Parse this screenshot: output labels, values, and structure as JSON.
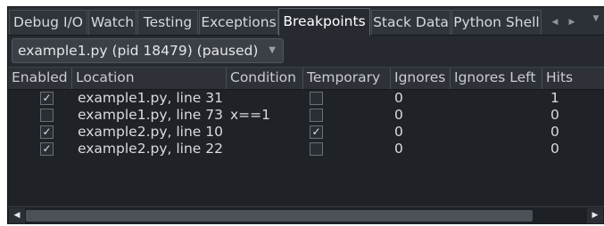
{
  "tabs": [
    {
      "label": "Debug I/O",
      "active": false
    },
    {
      "label": "Watch",
      "active": false
    },
    {
      "label": "Testing",
      "active": false
    },
    {
      "label": "Exceptions",
      "active": false
    },
    {
      "label": "Breakpoints",
      "active": true
    },
    {
      "label": "Stack Data",
      "active": false
    },
    {
      "label": "Python Shell",
      "active": false
    }
  ],
  "tab_controls": {
    "scroll_left": "◀",
    "scroll_right": "▶",
    "menu": "▼"
  },
  "process": {
    "selected": "example1.py (pid 18479) (paused)",
    "chevron": "▼"
  },
  "table": {
    "columns": [
      "Enabled",
      "Location",
      "Condition",
      "Temporary",
      "Ignores",
      "Ignores Left",
      "Hits"
    ],
    "rows": [
      {
        "enabled": true,
        "location": "example1.py, line 31",
        "condition": "",
        "temporary": false,
        "ignores": "0",
        "ignores_left": "",
        "hits": "1"
      },
      {
        "enabled": false,
        "location": "example1.py, line 73",
        "condition": "x==1",
        "temporary": false,
        "ignores": "0",
        "ignores_left": "",
        "hits": "0"
      },
      {
        "enabled": true,
        "location": "example2.py, line 10",
        "condition": "",
        "temporary": true,
        "ignores": "0",
        "ignores_left": "",
        "hits": "0"
      },
      {
        "enabled": true,
        "location": "example2.py, line 22",
        "condition": "",
        "temporary": false,
        "ignores": "0",
        "ignores_left": "",
        "hits": "0"
      }
    ]
  },
  "scrollbar": {
    "left_arrow": "◀",
    "right_arrow": "▶"
  },
  "check_glyph": "✓"
}
